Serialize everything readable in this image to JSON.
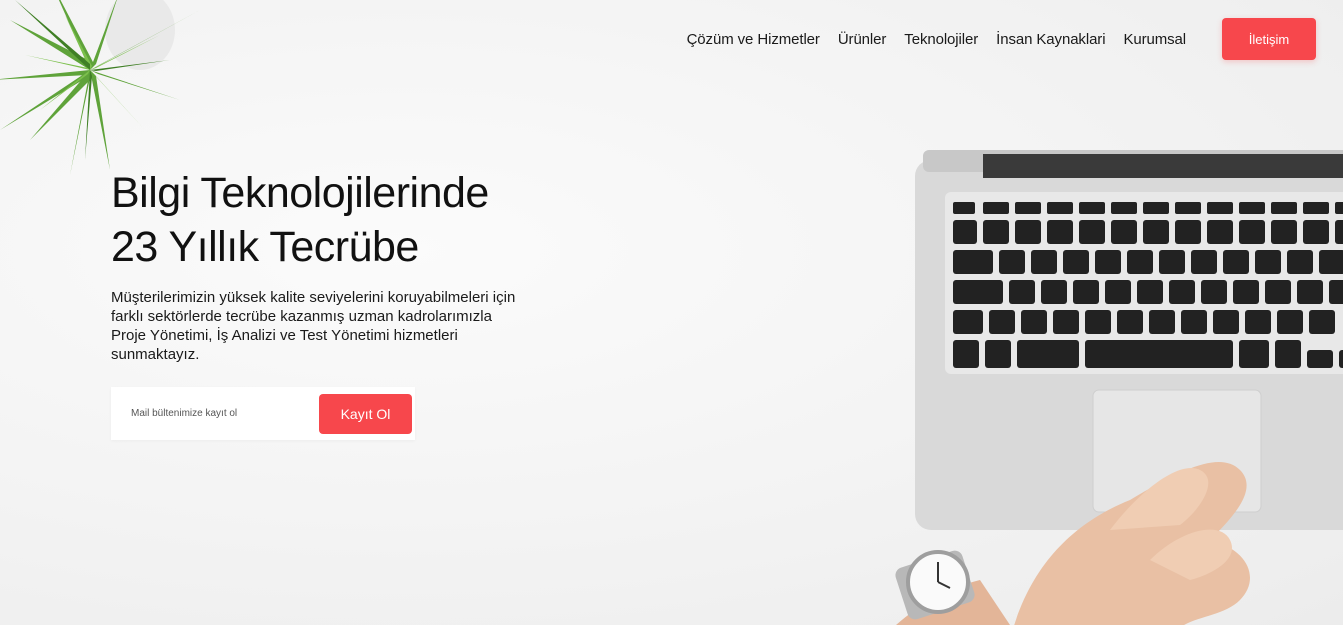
{
  "nav": {
    "items": [
      {
        "label": "Çözüm ve Hizmetler"
      },
      {
        "label": "Ürünler"
      },
      {
        "label": "Teknolojiler"
      },
      {
        "label": "İnsan Kaynaklari"
      },
      {
        "label": "Kurumsal"
      }
    ],
    "cta_label": "İletişim"
  },
  "hero": {
    "headline_line1": "Bilgi Teknolojilerinde",
    "headline_line2": "23 Yıllık Tecrübe",
    "description": "Müşterilerimizin yüksek kalite seviyelerini koruyabilmeleri için farklı sektörlerde tecrübe kazanmış uzman kadrolarımızla Proje Yönetimi, İş Analizi ve Test Yönetimi hizmetleri sunmaktayız."
  },
  "subscribe": {
    "placeholder": "Mail bültenimize kayıt ol",
    "value": "",
    "button_label": "Kayıt Ol"
  },
  "colors": {
    "accent": "#f7474c",
    "text": "#111111",
    "background": "#f4f4f4"
  },
  "icons": [
    "plant-decoration",
    "laptop-decoration",
    "hands-watch-decoration"
  ]
}
